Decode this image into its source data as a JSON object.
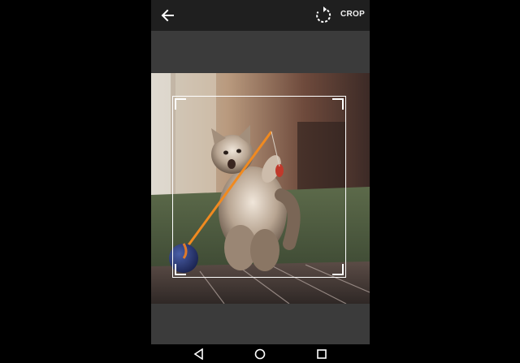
{
  "appbar": {
    "back_icon": "arrow-left-icon",
    "rotate_icon": "rotate-icon",
    "crop_label": "CROP"
  },
  "image": {
    "subject": "kitten-playing-with-toy-photo"
  },
  "navbar": {
    "back_icon": "nav-back-triangle-icon",
    "home_icon": "nav-home-circle-icon",
    "recents_icon": "nav-recents-square-icon"
  },
  "colors": {
    "appbar_bg": "#1f1f1f",
    "workspace_bg": "#3b3b3b",
    "frame": "#ffffff"
  }
}
